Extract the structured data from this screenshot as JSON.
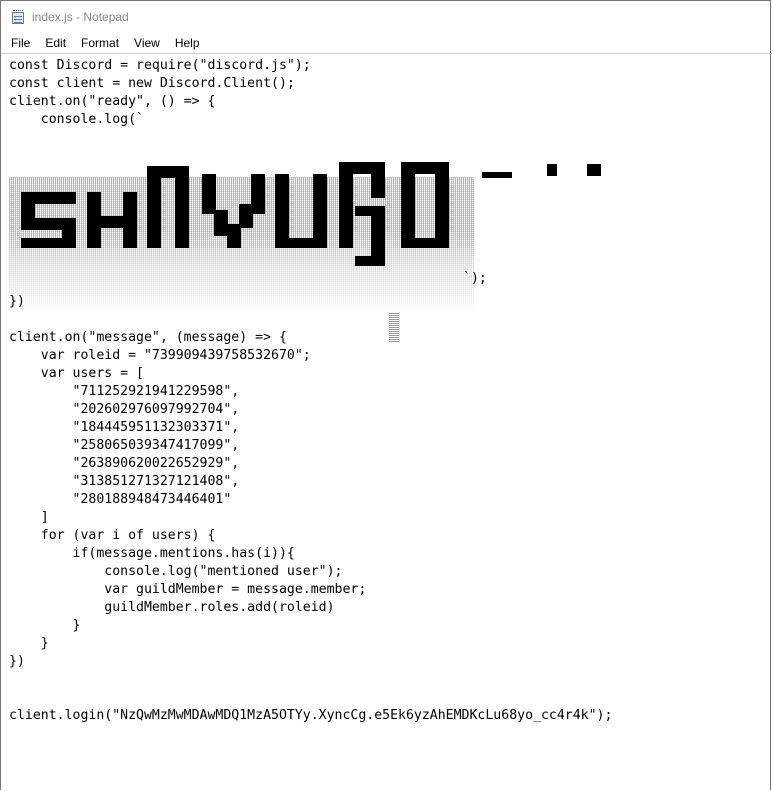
{
  "window": {
    "title": "index.js - Notepad"
  },
  "menu": [
    "File",
    "Edit",
    "Format",
    "View",
    "Help"
  ],
  "code": {
    "before_banner": "const Discord = require(\"discord.js\");\nconst client = new Discord.Client();\nclient.on(\"ready\", () => {\n    console.log(`",
    "banner_close": "`);",
    "after_banner": "})\n\nclient.on(\"message\", (message) => {\n    var roleid = \"739909439758532670\";\n    var users = [\n        \"711252921941229598\",\n        \"202602976097992704\",\n        \"184445951132303371\",\n        \"258065039347417099\",\n        \"263890620022652929\",\n        \"313851271327121408\",\n        \"280188948473446401\"\n    ]\n    for (var i of users) {\n        if(message.mentions.has(i)){\n            console.log(\"mentioned user\");\n            var guildMember = message.member;\n            guildMember.roles.add(roleid)\n        }\n    }\n})\n\n\nclient.login(\"NzQwMzMwMDAwMDQ1MzA5OTYy.XyncCg.e5Ek6yzAhEMDKcLu68yo_cc4r4k\");"
  }
}
